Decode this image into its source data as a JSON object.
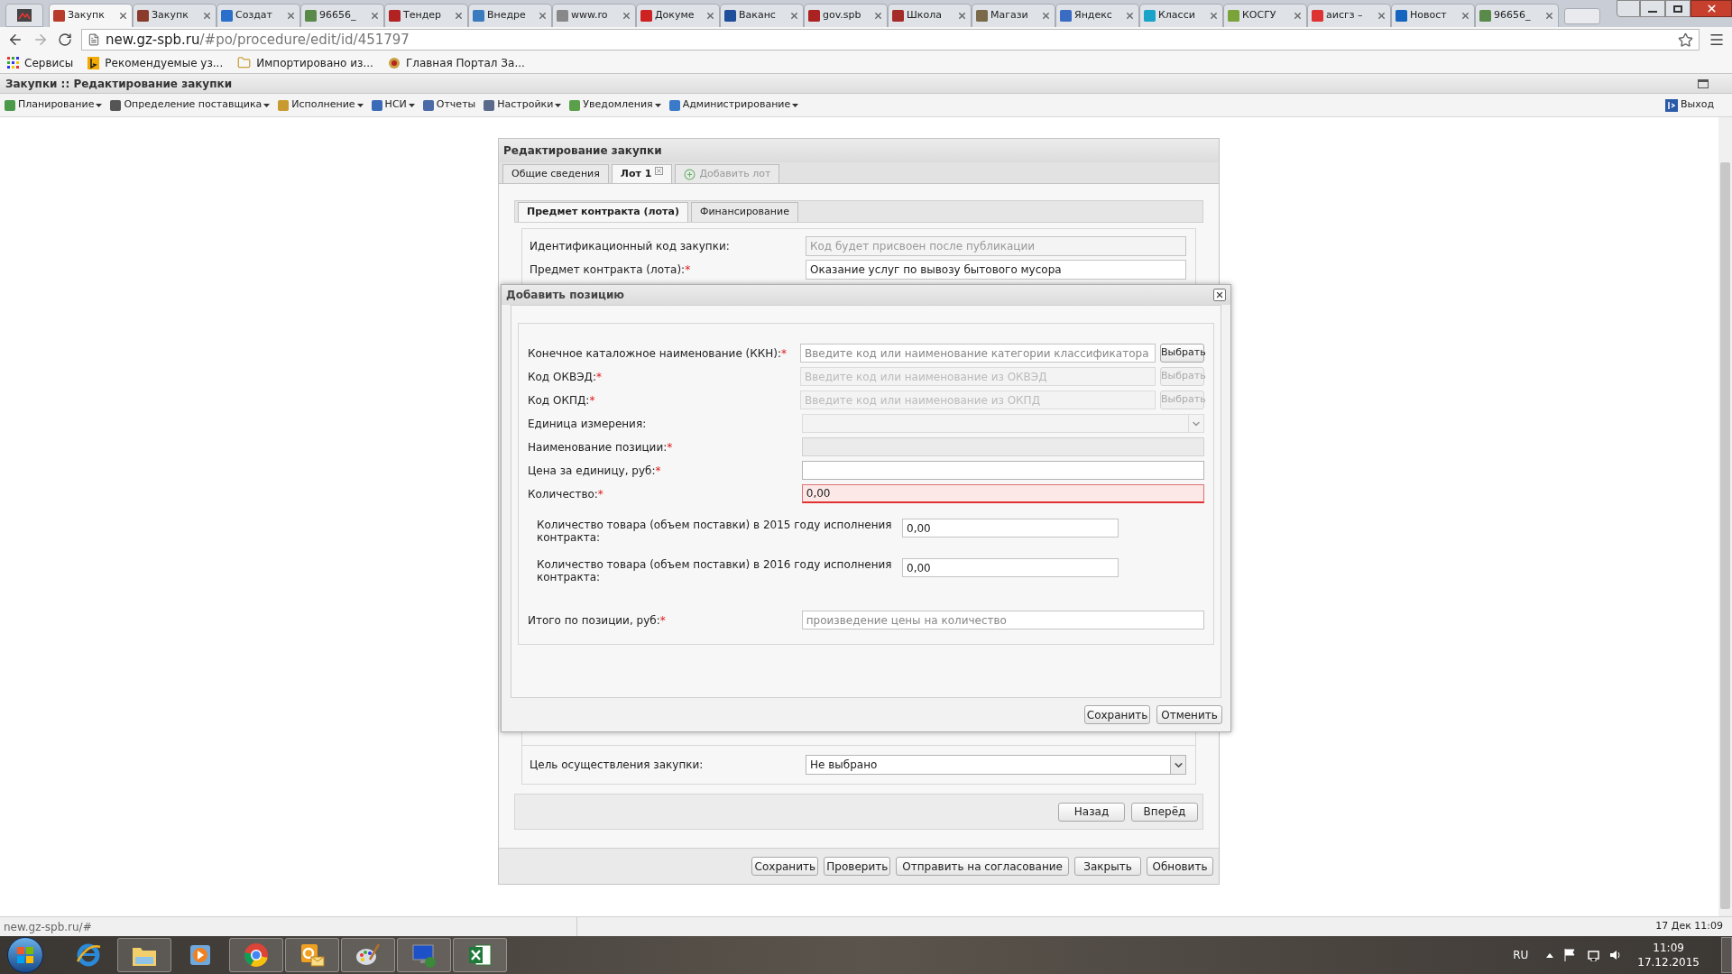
{
  "browser": {
    "tabs": [
      {
        "title": "Закупк",
        "selected": true
      },
      {
        "title": "Закупк",
        "selected": false
      },
      {
        "title": "Создат",
        "selected": false
      },
      {
        "title": "96656_",
        "selected": false
      },
      {
        "title": "Тендер",
        "selected": false
      },
      {
        "title": "Внедре",
        "selected": false
      },
      {
        "title": "www.ro",
        "selected": false
      },
      {
        "title": "Докуме",
        "selected": false
      },
      {
        "title": "Ваканс",
        "selected": false
      },
      {
        "title": "gov.spb",
        "selected": false
      },
      {
        "title": "Школа",
        "selected": false
      },
      {
        "title": "Магази",
        "selected": false
      },
      {
        "title": "Яндекс",
        "selected": false
      },
      {
        "title": "Класси",
        "selected": false
      },
      {
        "title": "КОСГУ",
        "selected": false
      },
      {
        "title": "аисгз –",
        "selected": false
      },
      {
        "title": "Новост",
        "selected": false
      },
      {
        "title": "96656_",
        "selected": false
      }
    ],
    "address": {
      "host": "new.gz-spb.ru",
      "path": "/#po/procedure/edit/id/451797"
    },
    "bookmarks": [
      {
        "kind": "apps",
        "label": "Сервисы"
      },
      {
        "kind": "site",
        "label": "Рекомендуемые уз..."
      },
      {
        "kind": "folder",
        "label": "Импортировано из..."
      },
      {
        "kind": "emblem",
        "label": "Главная Портал За..."
      }
    ]
  },
  "app": {
    "title": "Закупки :: Редактирование закупки",
    "menu": [
      {
        "label": "Планирование",
        "dropdown": true
      },
      {
        "label": "Определение поставщика",
        "dropdown": true
      },
      {
        "label": "Исполнение",
        "dropdown": true
      },
      {
        "label": "НСИ",
        "dropdown": true
      },
      {
        "label": "Отчеты",
        "dropdown": false
      },
      {
        "label": "Настройки",
        "dropdown": true
      },
      {
        "label": "Уведомления",
        "dropdown": true
      },
      {
        "label": "Администрирование",
        "dropdown": true
      }
    ],
    "logout": "Выход"
  },
  "panel": {
    "title": "Редактирование закупки",
    "tabs": [
      {
        "label": "Общие сведения",
        "selected": false,
        "kind": "tab"
      },
      {
        "label": "Лот 1",
        "selected": true,
        "kind": "closable"
      },
      {
        "label": "Добавить лот",
        "selected": false,
        "kind": "add"
      }
    ],
    "subtabs": [
      {
        "label": "Предмет контракта (лота)",
        "selected": true
      },
      {
        "label": "Финансирование",
        "selected": false
      }
    ],
    "fields": [
      {
        "label": "Идентификационный код закупки:",
        "placeholder": "Код будет присвоен после публикации"
      },
      {
        "label": "Предмет контракта (лота):",
        "mark": "*",
        "value": "Оказание услуг по вывозу бытового мусора"
      }
    ],
    "purpose": {
      "label": "Цель осуществления закупки:",
      "value": "Не выбрано"
    },
    "nav_buttons": [
      "Назад",
      "Вперёд"
    ],
    "buttons": [
      "Сохранить",
      "Проверить",
      "Отправить на согласование",
      "Закрыть",
      "Обновить"
    ]
  },
  "dialog": {
    "title": "Добавить позицию",
    "fields": [
      {
        "kind": "lookup",
        "label": "Конечное каталожное наименование (ККН):",
        "mark": "*",
        "placeholder": "Введите код или наименование категории классификатора",
        "button": "Выбрать",
        "disabled": false
      },
      {
        "kind": "lookup",
        "label": "Код ОКВЭД:",
        "mark": "*",
        "placeholder": "Введите код или наименование из ОКВЭД",
        "button": "Выбрать",
        "disabled": true
      },
      {
        "kind": "lookup",
        "label": "Код ОКПД:",
        "mark": "*",
        "placeholder": "Введите код или наименование из ОКПД",
        "button": "Выбрать",
        "disabled": true
      },
      {
        "kind": "select",
        "label": "Единица измерения:",
        "disabled": true
      },
      {
        "kind": "text",
        "label": "Наименование позиции:",
        "mark": "*",
        "disabled": true
      },
      {
        "kind": "text",
        "label": "Цена за единицу, руб:",
        "mark": "*",
        "disabled": false
      },
      {
        "kind": "text",
        "label": "Количество:",
        "mark": "*",
        "value": "0,00",
        "invalid": true
      }
    ],
    "sub_fields": [
      {
        "label": "Количество товара (объем поставки) в 2015 году исполнения контракта:",
        "value": "0,00"
      },
      {
        "label": "Количество товара (объем поставки) в 2016 году исполнения контракта:",
        "value": "0,00"
      }
    ],
    "total": {
      "label": "Итого по позиции, руб:",
      "mark": "*",
      "placeholder": "произведение цены на количество"
    },
    "buttons": [
      "Сохранить",
      "Отменить"
    ]
  },
  "status_bar": {
    "url": "new.gz-spb.ru/#",
    "datetime": "17 Дек 11:09"
  },
  "taskbar": {
    "apps": [
      {
        "kind": "ie",
        "running": false
      },
      {
        "kind": "folder",
        "running": true
      },
      {
        "kind": "media",
        "running": false
      },
      {
        "kind": "chrome",
        "running": true
      },
      {
        "kind": "mail",
        "running": true
      },
      {
        "kind": "paint",
        "running": true
      },
      {
        "kind": "remote",
        "running": true
      },
      {
        "kind": "sheet",
        "running": true
      }
    ],
    "lang": "RU",
    "time": "11:09",
    "date": "17.12.2015"
  }
}
